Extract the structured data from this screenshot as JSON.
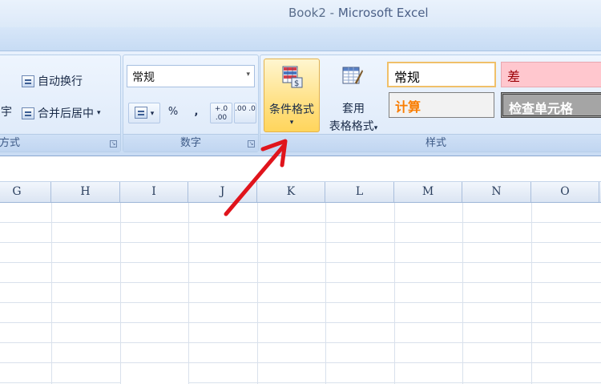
{
  "window": {
    "title_doc": "Book2",
    "title_sep": " - ",
    "title_app": "Microsoft Excel"
  },
  "alignment_group": {
    "wrap_text": "自动换行",
    "merge_center": "合并后居中",
    "merge_arrow": "▾",
    "clipped_char": "宇",
    "label": "方式"
  },
  "number_group": {
    "format_value": "常规",
    "format_arrow": "▾",
    "currency_arrow": "▾",
    "percent": "%",
    "comma": ",",
    "inc_decimal": "+.0 .00",
    "dec_decimal": ".00 .0",
    "label": "数字"
  },
  "styles_group": {
    "conditional_format": "条件格式",
    "conditional_arrow": "▾",
    "table_format_line1": "套用",
    "table_format_line2": "表格格式",
    "table_format_arrow": "▾",
    "style_normal": "常规",
    "style_bad": "差",
    "style_calc": "计算",
    "style_check": "检查单元格",
    "label": "样式"
  },
  "columns": [
    "G",
    "H",
    "I",
    "J",
    "K",
    "L",
    "M",
    "N",
    "O"
  ],
  "colors": {
    "highlight": "#ffd55c",
    "arrow": "#e0141c",
    "bad_bg": "#ffc7ce",
    "bad_text": "#9c0006",
    "calc_text": "#fa7d00",
    "check_bg": "#a5a5a5"
  }
}
